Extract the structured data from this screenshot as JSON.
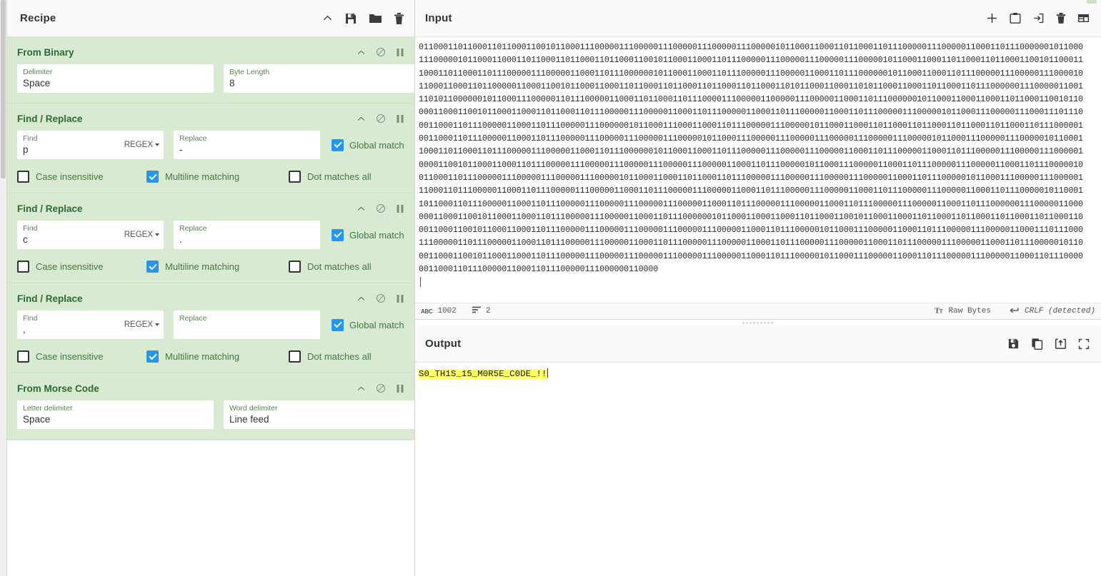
{
  "recipe": {
    "title": "Recipe",
    "toolbar": [
      {
        "name": "collapse-icon",
        "label": "Collapse"
      },
      {
        "name": "save-recipe-icon",
        "label": "Save recipe"
      },
      {
        "name": "load-recipe-icon",
        "label": "Load recipe"
      },
      {
        "name": "clear-recipe-icon",
        "label": "Clear recipe"
      }
    ],
    "operations": [
      {
        "name": "From Binary",
        "type": "simple",
        "fields": [
          {
            "label": "Delimiter",
            "value": "Space"
          },
          {
            "label": "Byte Length",
            "value": "8"
          }
        ]
      },
      {
        "name": "Find / Replace",
        "type": "find-replace",
        "find_label": "Find",
        "find_value": "p",
        "find_mode": "REGEX",
        "replace_label": "Replace",
        "replace_value": "-",
        "global_match": {
          "label": "Global match",
          "checked": true
        },
        "options": [
          {
            "label": "Case insensitive",
            "checked": false
          },
          {
            "label": "Multiline matching",
            "checked": true
          },
          {
            "label": "Dot matches all",
            "checked": false
          }
        ]
      },
      {
        "name": "Find / Replace",
        "type": "find-replace",
        "find_label": "Find",
        "find_value": "c",
        "find_mode": "REGEX",
        "replace_label": "Replace",
        "replace_value": ".",
        "global_match": {
          "label": "Global match",
          "checked": true
        },
        "options": [
          {
            "label": "Case insensitive",
            "checked": false
          },
          {
            "label": "Multiline matching",
            "checked": true
          },
          {
            "label": "Dot matches all",
            "checked": false
          }
        ]
      },
      {
        "name": "Find / Replace",
        "type": "find-replace",
        "find_label": "Find",
        "find_value": ",",
        "find_mode": "REGEX",
        "replace_label": "Replace",
        "replace_value": "",
        "global_match": {
          "label": "Global match",
          "checked": true
        },
        "options": [
          {
            "label": "Case insensitive",
            "checked": false
          },
          {
            "label": "Multiline matching",
            "checked": true
          },
          {
            "label": "Dot matches all",
            "checked": false
          }
        ]
      },
      {
        "name": "From Morse Code",
        "type": "simple",
        "fields": [
          {
            "label": "Letter delimiter",
            "value": "Space"
          },
          {
            "label": "Word delimiter",
            "value": "Line feed"
          }
        ]
      }
    ]
  },
  "input": {
    "title": "Input",
    "toolbar": [
      {
        "name": "add-input-tab-icon",
        "label": "Add new input tab"
      },
      {
        "name": "open-folder-icon",
        "label": "Open file as input"
      },
      {
        "name": "open-folder-input-icon",
        "label": "Open folder as input"
      },
      {
        "name": "clear-input-icon",
        "label": "Clear input and output"
      },
      {
        "name": "reset-pane-layout-icon",
        "label": "Reset pane layout"
      }
    ],
    "text": "0110001101100011011000110010110001110000011100000111000001110000011100000101100011000110110001101110000011100000110001101110000001011000\n1110000010110001100011011000110110001101100011001011000110001101110000011100000111000001110000010110001100011011000110110001100101100011\n1000110110001101110000011100000110001101110000001011000110001101110000011100000110001101110000001011000110001101110000011100000111000010\n1100011000110110000011000110010110001100011011000110110001101100011011000110101100011000110101100011000110110001101110000001110000011001\n1101011000000101100011100000110111000001100011011000110111000011100000110000011100000110001101110000001011000110001100011011000110010110\n0001100011001011000110001101100011011100000111000001100011011100000110001101110000011000110111000001110000010110001110000011100011101110\n0011000110111000001100011011100000111000000101100011100011000110111000001110000010110001100011011000110110001101100011011000110111000001\n0011000110111000001100011011100000111000001110000011100000101100011100000111000001110000011100000111000001011000111000001110000010110001\n1000110110001101110000011100000110001101110000001011000110001101110000011100000111000001100011011100000110001101110000011100000111000001\n0000110010110001100011011100000111000001110000011100000111000001100011011100000101100011100000110001101110000011100000110001101110000010\n0110001101110000011100000111000001110000010110001100011011000110111000001110000011100000111000001100011011100000101100011100000111000001\n1100011011100000110001101110000011100000110001101110000011100000110001101110000011100000110001101110000011100000110001101110000010110001\n1011000110111000001100011011100000111000001110000011100000110001101110000011100000110001101110000011100000110001101110000001110000011000\n0001100011001011000110001101110000011100000110001101110000001011000110001100011011000110010110001100011011000110110001101100011011000110\n0011000110010110001100011011100000111000001110000011100000111000001100011011100000101100011100000110001101110000011100000110001110111000\n1110000011011100000110001101110000011100000110001101110000011100000110001101110000011100000110001101110000011100000110001101110000010110\n0011000110010110001100011011100000111000001110000011100000111000001100011011100000101100011100000110001101110000011100000110001101110000\n0011000110111000001100011011100000111000000110000",
    "status": {
      "char_count": "1002",
      "line_count": "2",
      "encoding": "Raw Bytes",
      "line_ending": "CRLF (detected)"
    }
  },
  "output": {
    "title": "Output",
    "toolbar": [
      {
        "name": "save-output-icon",
        "label": "Save output to file"
      },
      {
        "name": "copy-output-icon",
        "label": "Copy raw output to the clipboard"
      },
      {
        "name": "replace-input-icon",
        "label": "Replace input with output"
      },
      {
        "name": "maximise-output-icon",
        "label": "Maximise output pane"
      }
    ],
    "text": "S0_TH1S_15_M0R5E_C0DE_!!"
  },
  "colors": {
    "op_background": "#d9ead3",
    "op_title": "#2e6930",
    "checkbox_on": "#2196f3",
    "label_green": "#3f7a3c",
    "output_highlight": "#ffff66"
  }
}
